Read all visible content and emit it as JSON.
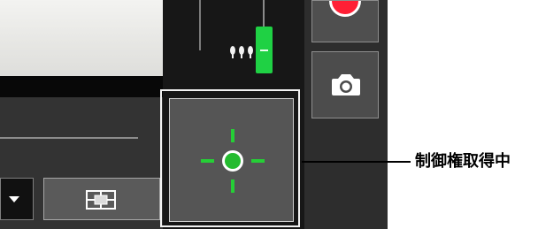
{
  "screen": {
    "title": "",
    "callout_label": "制御権取得中"
  },
  "buttons": {
    "record": "record-icon",
    "camera": "camera-icon",
    "control": "crosshair-icon",
    "grid": "grid-icon",
    "dropdown": "chevron-down-icon"
  },
  "slider": {
    "icon": "lights-icon"
  },
  "colors": {
    "accent_green": "#1fd144",
    "record_red": "#ff1f35"
  }
}
